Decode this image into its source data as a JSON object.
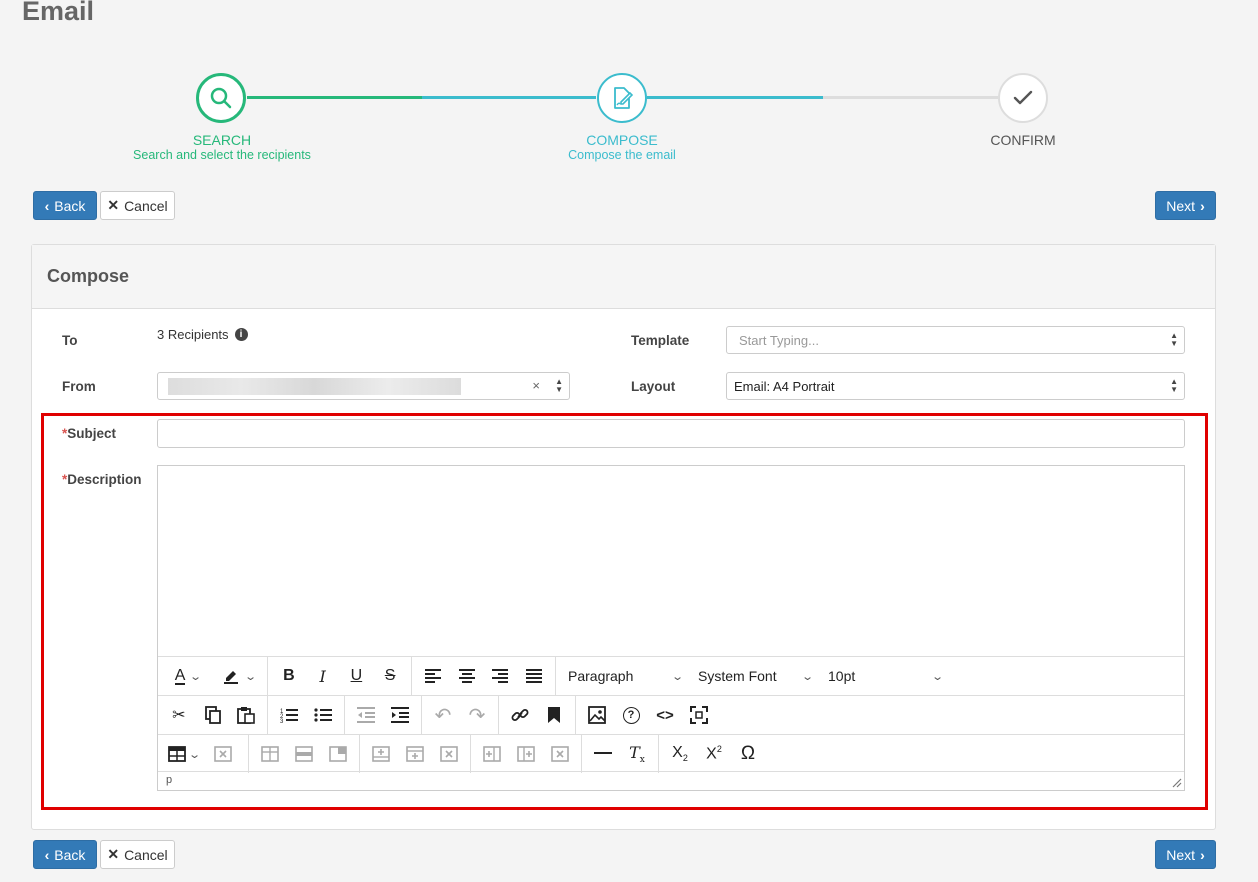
{
  "page": {
    "title": "Email"
  },
  "wizard": {
    "steps": [
      {
        "title": "SEARCH",
        "subtitle": "Search and select the recipients"
      },
      {
        "title": "COMPOSE",
        "subtitle": "Compose the email"
      },
      {
        "title": "CONFIRM",
        "subtitle": ""
      }
    ],
    "colors": {
      "done": "#26b87a",
      "active": "#3bbccd",
      "pending": "#dddddd"
    }
  },
  "nav": {
    "back_label": "Back",
    "cancel_label": "Cancel",
    "next_label": "Next"
  },
  "compose": {
    "heading": "Compose",
    "to": {
      "label": "To",
      "value": "3 Recipients"
    },
    "template": {
      "label": "Template",
      "placeholder": "Start Typing..."
    },
    "from": {
      "label": "From",
      "clear": "×"
    },
    "layout": {
      "label": "Layout",
      "value": "Email: A4 Portrait"
    },
    "subject": {
      "required_mark": "*",
      "label": "Subject",
      "value": ""
    },
    "description": {
      "required_mark": "*",
      "label": "Description"
    }
  },
  "editor": {
    "block_format": "Paragraph",
    "font_family": "System Font",
    "font_size": "10pt",
    "status_path": "p"
  }
}
